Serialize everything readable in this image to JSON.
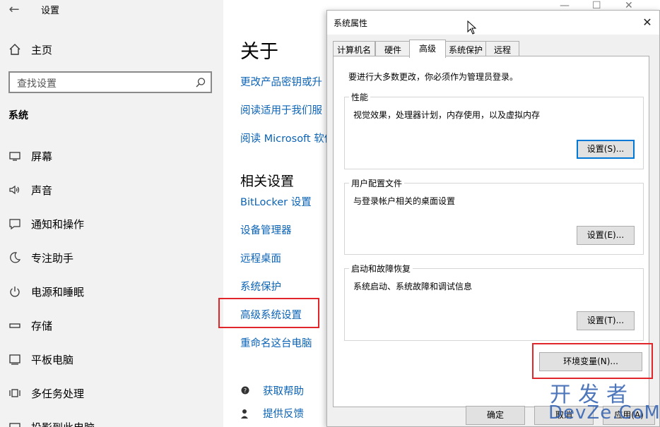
{
  "settings": {
    "title": "设置",
    "home_label": "主页",
    "search_placeholder": "查找设置",
    "section": "系统",
    "nav": [
      {
        "label": "屏幕",
        "icon": "monitor-icon"
      },
      {
        "label": "声音",
        "icon": "speaker-icon"
      },
      {
        "label": "通知和操作",
        "icon": "notification-icon"
      },
      {
        "label": "专注助手",
        "icon": "moon-icon"
      },
      {
        "label": "电源和睡眠",
        "icon": "power-icon"
      },
      {
        "label": "存储",
        "icon": "storage-icon"
      },
      {
        "label": "平板电脑",
        "icon": "tablet-icon"
      },
      {
        "label": "多任务处理",
        "icon": "multitask-icon"
      },
      {
        "label": "投影到此电脑",
        "icon": "project-icon"
      }
    ]
  },
  "about": {
    "title": "关于",
    "links_top": [
      "更改产品密钥或升",
      "阅读适用于我们服",
      "阅读 Microsoft 软件"
    ],
    "related_title": "相关设置",
    "related_links": [
      "BitLocker 设置",
      "设备管理器",
      "远程桌面",
      "系统保护",
      "高级系统设置",
      "重命名这台电脑"
    ],
    "help": {
      "get_help": "获取帮助",
      "feedback": "提供反馈"
    }
  },
  "dialog": {
    "title": "系统属性",
    "close": "✕",
    "tabs": [
      "计算机名",
      "硬件",
      "高级",
      "系统保护",
      "远程"
    ],
    "active_tab": "高级",
    "admin_note": "要进行大多数更改，你必须作为管理员登录。",
    "groups": [
      {
        "legend": "性能",
        "desc": "视觉效果，处理器计划，内存使用，以及虚拟内存",
        "button": "设置(S)..."
      },
      {
        "legend": "用户配置文件",
        "desc": "与登录帐户相关的桌面设置",
        "button": "设置(E)..."
      },
      {
        "legend": "启动和故障恢复",
        "desc": "系统启动、系统故障和调试信息",
        "button": "设置(T)..."
      }
    ],
    "env_button": "环境变量(N)...",
    "ok_button": "确定",
    "cancel_button": "取消",
    "apply_button": "应用(A)"
  },
  "watermark": {
    "top": "开发者",
    "bottom": "DevZe.CoM"
  },
  "colors": {
    "link": "#0b63b6",
    "highlight": "#e0262a",
    "focus": "#0078d7"
  }
}
